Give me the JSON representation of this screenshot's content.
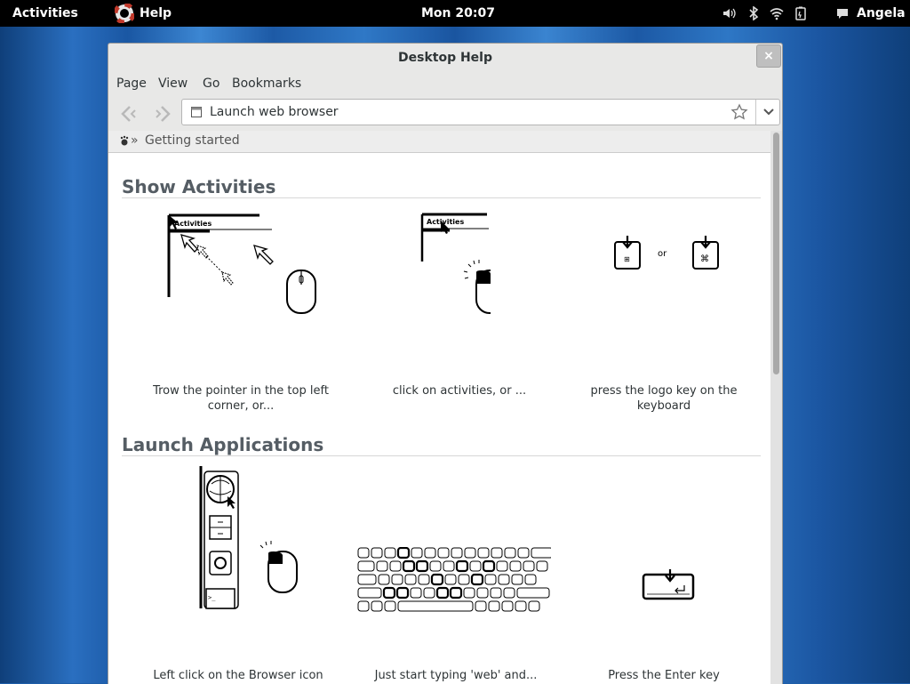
{
  "topbar": {
    "activities": "Activities",
    "app_name": "Help",
    "clock": "Mon 20:07",
    "user": "Angela",
    "icons": [
      "app-help-icon",
      "volume-icon",
      "bluetooth-icon",
      "wifi-icon",
      "battery-icon",
      "chat-icon"
    ]
  },
  "window": {
    "title": "Desktop Help",
    "close": "×",
    "menu": [
      "Page",
      "View",
      "Go",
      "Bookmarks"
    ],
    "url": "Launch web browser",
    "breadcrumb_sep": "»",
    "breadcrumb": "Getting started"
  },
  "sections": [
    {
      "heading": "Show Activities",
      "captions": [
        "Trow the pointer in the top left corner, or...",
        "click on activities, or ...",
        "press the logo key on the keyboard"
      ],
      "illus_text": {
        "activities": "Activities",
        "activities_short": "Activities",
        "or": "or"
      }
    },
    {
      "heading": "Launch Applications",
      "captions": [
        "Left click on the Browser icon on the dash, or....",
        "Just start typing 'web' and...",
        "Press the Enter key"
      ]
    }
  ],
  "colors": {
    "topbar": "#000000",
    "window_bg": "#e8e8e7",
    "heading": "#555d64"
  }
}
